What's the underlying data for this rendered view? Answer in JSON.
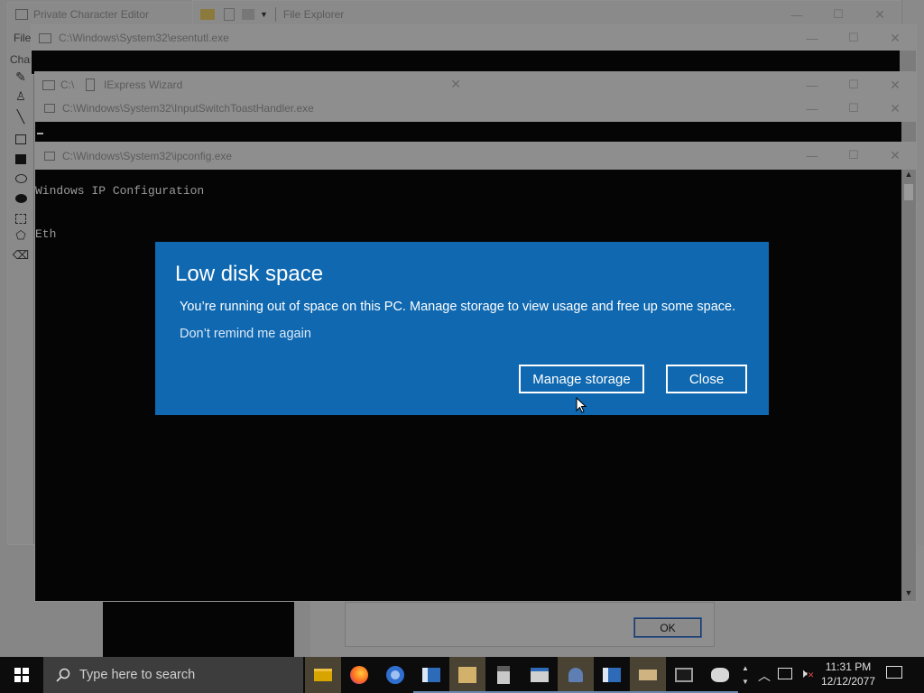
{
  "windows": {
    "private_char_editor": {
      "title": "Private Character Editor",
      "menu_file": "File",
      "menu_char": "Char"
    },
    "file_explorer": {
      "title": "File Explorer"
    },
    "esentutl": {
      "title": "C:\\Windows\\System32\\esentutl.exe"
    },
    "iexpress": {
      "title": "IExpress Wizard",
      "prefix": "C:\\"
    },
    "toast_handler": {
      "title": "C:\\Windows\\System32\\InputSwitchToastHandler.exe"
    },
    "ipconfig": {
      "title": "C:\\Windows\\System32\\ipconfig.exe",
      "line1": "Windows IP Configuration",
      "line2": "Eth"
    },
    "dialog_ok": {
      "label": "OK"
    }
  },
  "toast": {
    "title": "Low disk space",
    "message": "You’re running out of space on this PC. Manage storage to view usage and free up some space.",
    "remind": "Don’t remind me again",
    "primary_button": "Manage storage",
    "secondary_button": "Close",
    "accent": "#0f68b0"
  },
  "taskbar": {
    "search_placeholder": "Type here to search",
    "time": "11:31 PM",
    "date": "12/12/2077"
  }
}
